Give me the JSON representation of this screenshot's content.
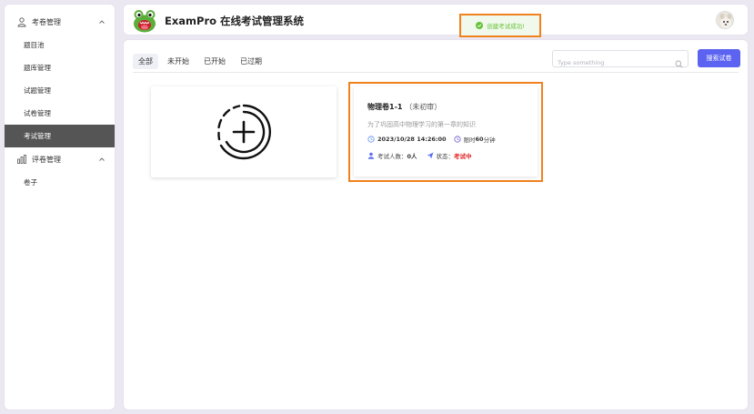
{
  "sidebar": {
    "groups": [
      {
        "label": "考卷管理",
        "icon": "user-icon",
        "items": [
          {
            "label": "题目池"
          },
          {
            "label": "题库管理"
          },
          {
            "label": "试题管理"
          },
          {
            "label": "试卷管理"
          },
          {
            "label": "考试管理"
          }
        ]
      },
      {
        "label": "评卷管理",
        "icon": "bar-chart-icon",
        "items": [
          {
            "label": "卷子"
          }
        ]
      }
    ],
    "active_item": "考试管理"
  },
  "header": {
    "title": "ExamPro 在线考试管理系统",
    "toast": "创建考试成功!"
  },
  "main": {
    "tabs": [
      {
        "label": "全部"
      },
      {
        "label": "未开始"
      },
      {
        "label": "已开始"
      },
      {
        "label": "已过期"
      }
    ],
    "active_tab": "全部",
    "search": {
      "placeholder": "Type something",
      "value": ""
    },
    "search_button": "搜索试卷",
    "exam": {
      "title": "物理卷1-1",
      "review_status": "（未初审）",
      "description": "为了巩固高中物理学习的第一章的知识",
      "date": "2023/10/28 14:26:00",
      "limit_prefix": "限时",
      "limit_value": "60",
      "limit_unit": "分钟",
      "participants_label": "考试人数：",
      "participants_value": "0人",
      "status_label": "状态：",
      "status_value": "考试中"
    }
  },
  "colors": {
    "accent": "#5b63f0",
    "highlight_border": "#f0821e",
    "active_nav_bg": "#555555",
    "success": "#67c23a",
    "status_running": "#e02020"
  }
}
